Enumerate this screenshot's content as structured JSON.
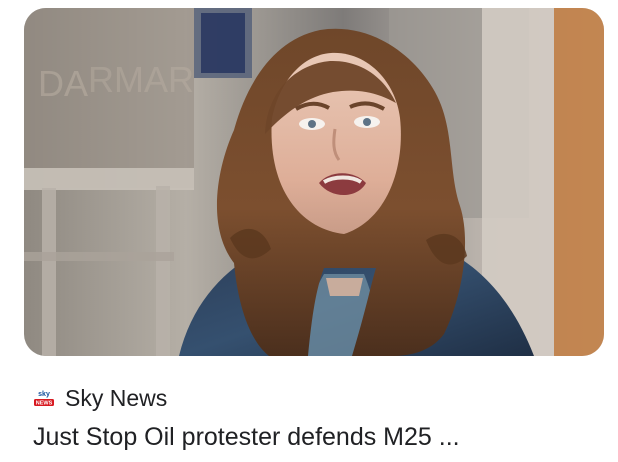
{
  "result": {
    "source_name": "Sky News",
    "headline": "Just Stop Oil protester defends M25 ...",
    "thumbnail_alt": "Just Stop Oil protester",
    "source_icon": "sky-news-logo-icon"
  },
  "colors": {
    "text": "#202124",
    "sky_red": "#d71920"
  }
}
